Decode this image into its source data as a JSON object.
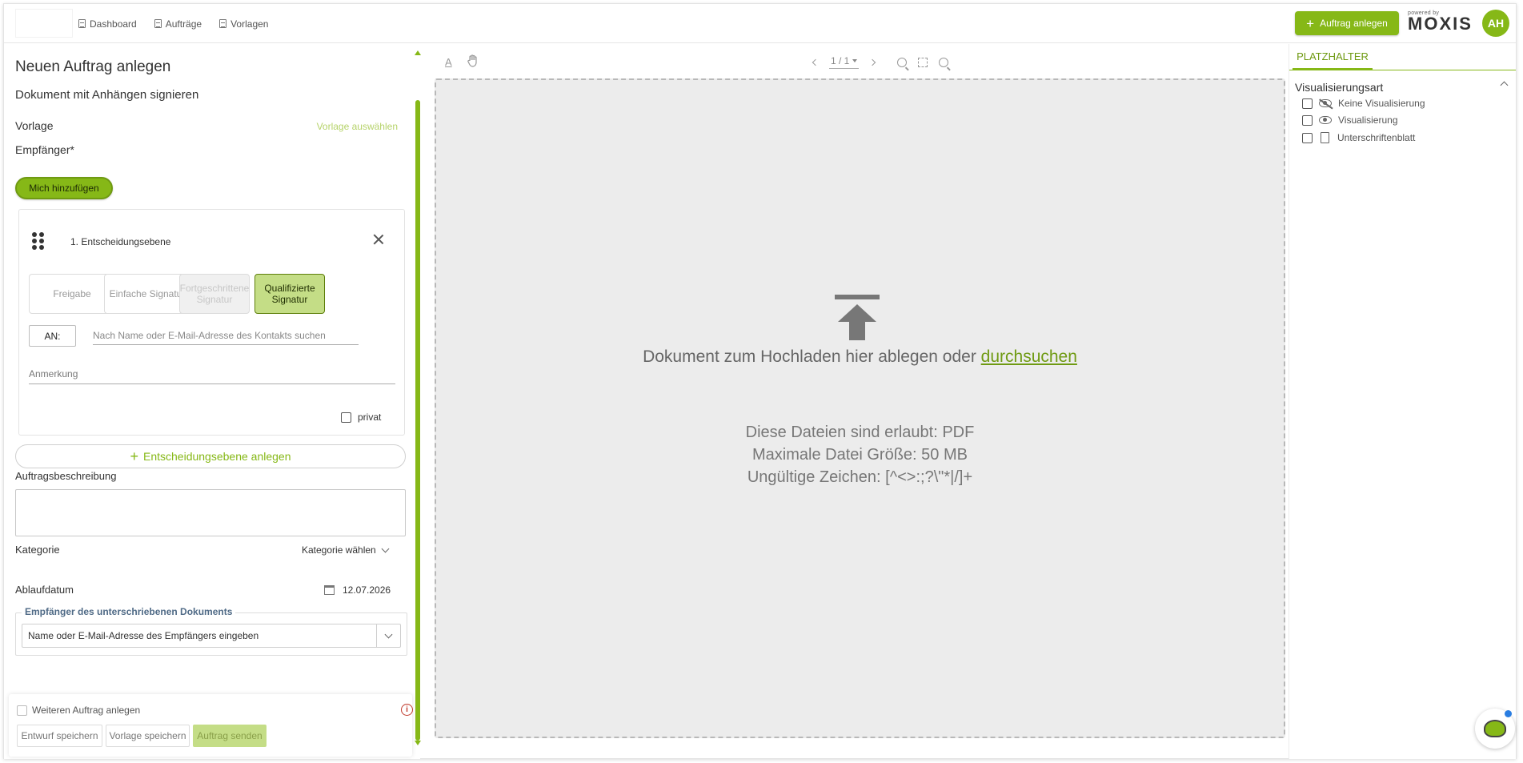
{
  "header": {
    "nav": [
      "Dashboard",
      "Aufträge",
      "Vorlagen"
    ],
    "new_order_label": "Auftrag anlegen",
    "brand_small": "powered by",
    "brand_name": "MOXIS",
    "avatar_initials": "AH"
  },
  "form": {
    "title": "Neuen Auftrag anlegen",
    "subtitle": "Dokument mit Anhängen signieren",
    "template_label": "Vorlage",
    "template_link": "Vorlage auswählen",
    "recipients_label": "Empfänger*",
    "add_me_label": "Mich hinzufügen",
    "level": {
      "title": "1. Entscheidungsebene",
      "options": [
        "Freigabe",
        "Einfache Signatur",
        "Fortgeschrittene Signatur",
        "Qualifizierte Signatur"
      ],
      "selected": "Qualifizierte Signatur",
      "to_label": "AN:",
      "search_placeholder": "Nach Name oder E-Mail-Adresse des Kontakts suchen",
      "note_placeholder": "Anmerkung",
      "private_label": "privat"
    },
    "add_level_label": "Entscheidungsebene anlegen",
    "description_label": "Auftragsbeschreibung",
    "category_label": "Kategorie",
    "category_value": "Kategorie wählen",
    "expiry_label": "Ablaufdatum",
    "expiry_value": "12.07.2026",
    "signed_recipients_legend": "Empfänger des unterschriebenen Dokuments",
    "signed_recipients_placeholder": "Name oder E-Mail-Adresse des Empfängers eingeben"
  },
  "footer": {
    "more_order_label": "Weiteren Auftrag anlegen",
    "save_draft": "Entwurf speichern",
    "save_template": "Vorlage speichern",
    "send_order": "Auftrag senden"
  },
  "viewer": {
    "font_tool": "A",
    "page_indicator": "1 / 1",
    "drop_text": "Dokument zum Hochladen hier ablegen oder",
    "browse_link": "durchsuchen",
    "allowed_files": "Diese Dateien sind erlaubt: PDF",
    "max_size": "Maximale Datei Größe: 50 MB",
    "invalid_chars": "Ungültige Zeichen: [^<>:;?\\\"*|/]+"
  },
  "placeholder_panel": {
    "tab": "PLATZHALTER",
    "section_title": "Visualisierungsart",
    "options": [
      "Keine Visualisierung",
      "Visualisierung",
      "Unterschriftenblatt"
    ]
  },
  "colors": {
    "accent": "#86b817",
    "accent_light": "#c4dd86"
  }
}
